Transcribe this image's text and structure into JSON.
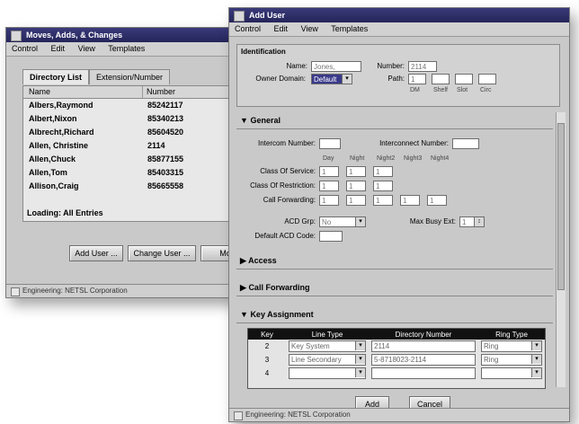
{
  "left_window": {
    "title": "Moves, Adds, & Changes",
    "menu": [
      "Control",
      "Edit",
      "View",
      "Templates"
    ],
    "tabs": [
      "Directory List",
      "Extension/Number"
    ],
    "columns": [
      "Name",
      "Number"
    ],
    "rows": [
      {
        "name": "Albers,Raymond",
        "number": "85242117"
      },
      {
        "name": "Albert,Nixon",
        "number": "85340213"
      },
      {
        "name": "Albrecht,Richard",
        "number": "85604520"
      },
      {
        "name": "Allen, Christine",
        "number": "2114"
      },
      {
        "name": "Allen,Chuck",
        "number": "85877155"
      },
      {
        "name": "Allen,Tom",
        "number": "85403315"
      },
      {
        "name": "Allison,Craig",
        "number": "85665558"
      }
    ],
    "loading": "Loading: All Entries",
    "buttons": [
      "Add User ...",
      "Change User ...",
      "Mod"
    ],
    "status": "Engineering: NETSL Corporation"
  },
  "right_window": {
    "title": "Add User",
    "menu": [
      "Control",
      "Edit",
      "View",
      "Templates"
    ],
    "identification": {
      "header": "Identification",
      "name_label": "Name:",
      "name_value": "Jones, Christine",
      "number_label": "Number:",
      "number_value": "2114",
      "owner_label": "Owner Domain:",
      "owner_value": "Default",
      "path_label": "Path:",
      "path_headers": [
        "DM",
        "Shelf",
        "Slot",
        "Circ"
      ],
      "path_values": [
        "1",
        "",
        "",
        ""
      ]
    },
    "general": {
      "header": "General",
      "intercom_label": "Intercom Number:",
      "intercom_value": "",
      "interconnect_label": "Interconnect Number:",
      "interconnect_value": "",
      "col_heads": [
        "Day",
        "Night",
        "Night2",
        "Night3",
        "Night4"
      ],
      "cos_label": "Class Of Service:",
      "cos_values": [
        "1",
        "1",
        "1"
      ],
      "restriction_label": "Class Of Restriction:",
      "restriction_values": [
        "1",
        "1",
        "1"
      ],
      "callforward_label": "Call Forwarding:",
      "callforward_values": [
        "1",
        "1",
        "1",
        "1",
        "1"
      ],
      "acd_label": "ACD Grp:",
      "acd_value": "No",
      "maxbusy_label": "Max Busy Ext:",
      "maxbusy_value": "1",
      "default_acd_label": "Default ACD Code:",
      "default_acd_value": ""
    },
    "sections": [
      "Access",
      "Call Forwarding",
      "Key Assignment"
    ],
    "key_table": {
      "columns": [
        "Key",
        "Line Type",
        "Directory Number",
        "Ring Type"
      ],
      "rows": [
        {
          "key": "2",
          "line_type": "Key System",
          "number": "2114",
          "ring": "Ring"
        },
        {
          "key": "3",
          "line_type": "Line Secondary",
          "number": "5-8718023-2114",
          "ring": "Ring"
        },
        {
          "key": "4",
          "line_type": "",
          "number": "",
          "ring": ""
        }
      ]
    },
    "buttons": [
      "Add",
      "Cancel"
    ],
    "status": "Engineering: NETSL Corporation"
  }
}
